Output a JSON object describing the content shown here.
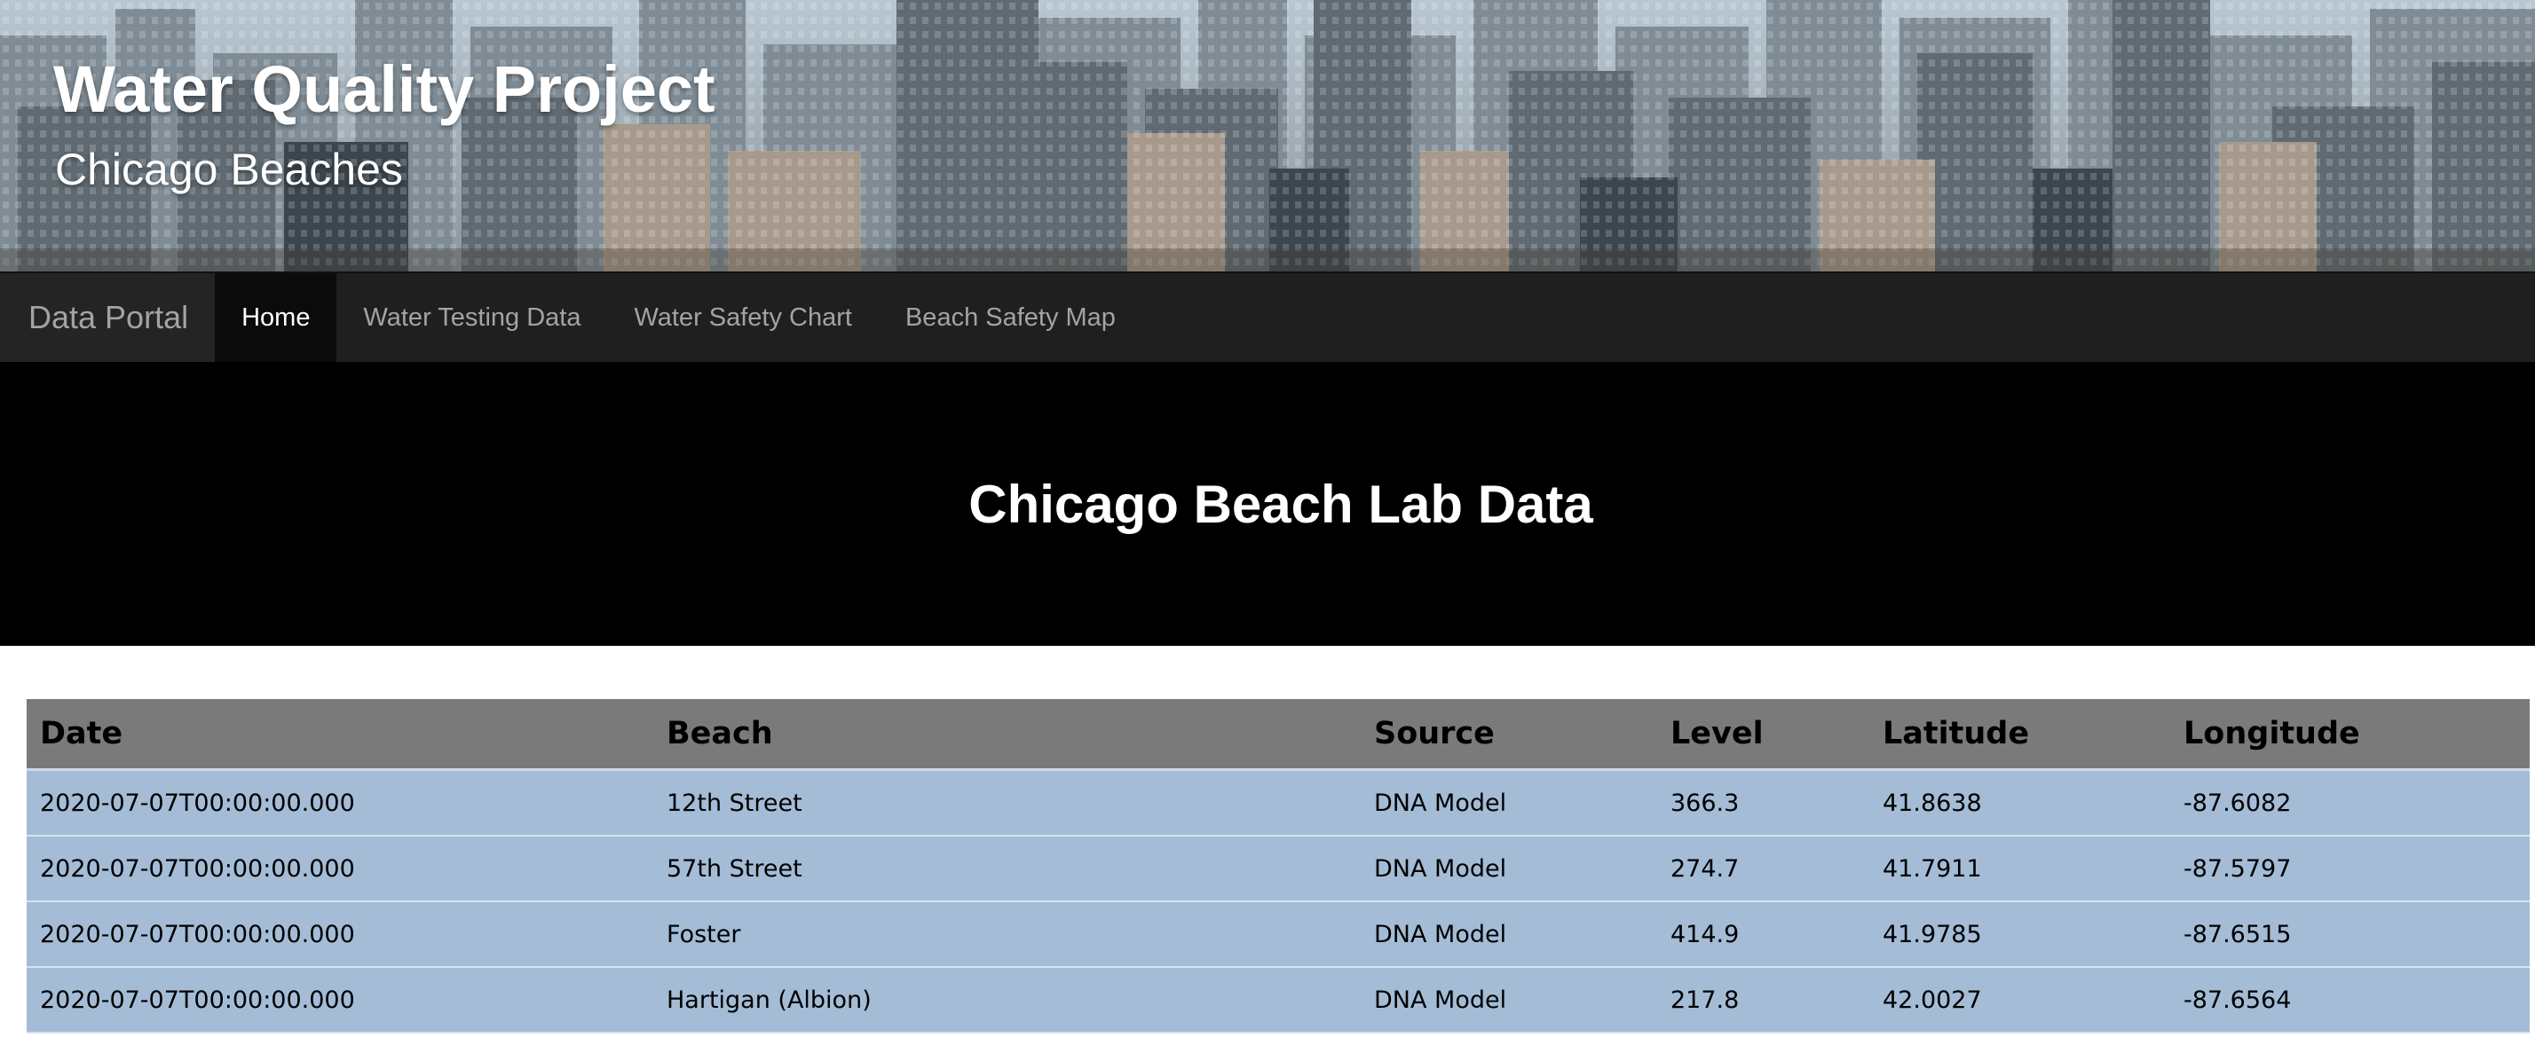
{
  "header": {
    "title": "Water Quality Project",
    "subtitle": "Chicago Beaches"
  },
  "navbar": {
    "brand": "Data Portal",
    "items": [
      {
        "label": "Home",
        "active": true
      },
      {
        "label": "Water Testing Data",
        "active": false
      },
      {
        "label": "Water Safety Chart",
        "active": false
      },
      {
        "label": "Beach Safety Map",
        "active": false
      }
    ]
  },
  "jumbotron": {
    "heading": "Chicago Beach Lab Data"
  },
  "table": {
    "headers": [
      "Date",
      "Beach",
      "Source",
      "Level",
      "Latitude",
      "Longitude"
    ],
    "rows": [
      [
        "2020-07-07T00:00:00.000",
        "12th Street",
        "DNA Model",
        "366.3",
        "41.8638",
        "-87.6082"
      ],
      [
        "2020-07-07T00:00:00.000",
        "57th Street",
        "DNA Model",
        "274.7",
        "41.7911",
        "-87.5797"
      ],
      [
        "2020-07-07T00:00:00.000",
        "Foster",
        "DNA Model",
        "414.9",
        "41.9785",
        "-87.6515"
      ],
      [
        "2020-07-07T00:00:00.000",
        "Hartigan (Albion)",
        "DNA Model",
        "217.8",
        "42.0027",
        "-87.6564"
      ]
    ]
  },
  "colors": {
    "navbar_bg": "#1f1f1f",
    "jumbotron_bg": "#000000",
    "table_header_bg": "#7a7a7a",
    "table_row_bg": "#a4bcd6"
  }
}
